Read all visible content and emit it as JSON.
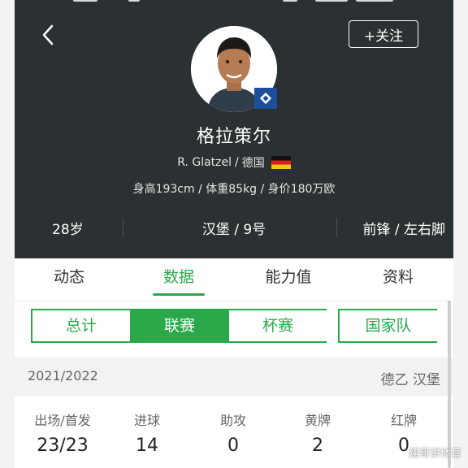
{
  "header": {
    "back_icon": "chevron-left-icon",
    "follow_label": "+关注"
  },
  "player": {
    "name_cn": "格拉策尔",
    "name_en": "R. Glatzel",
    "separator": "/",
    "nationality": "德国",
    "flag_icon": "germany-flag-icon",
    "physical": "身高193cm / 体重85kg / 身价180万欧",
    "age": "28岁",
    "club_number": "汉堡 / 9号",
    "position_foot": "前锋 / 左右脚",
    "club_badge_icon": "hamburg-badge-icon"
  },
  "tabs": [
    {
      "label": "动态",
      "active": false
    },
    {
      "label": "数据",
      "active": true
    },
    {
      "label": "能力值",
      "active": false
    },
    {
      "label": "资料",
      "active": false
    }
  ],
  "segments": [
    {
      "label": "总计",
      "active": false
    },
    {
      "label": "联赛",
      "active": true
    },
    {
      "label": "杯赛",
      "active": false
    },
    {
      "label": "国家队",
      "active": false
    }
  ],
  "season": {
    "label": "2021/2022",
    "league": "德乙 汉堡"
  },
  "stats": [
    {
      "label": "出场/首发",
      "value": "23/23"
    },
    {
      "label": "进球",
      "value": "14"
    },
    {
      "label": "助攻",
      "value": "0"
    },
    {
      "label": "黄牌",
      "value": "2"
    },
    {
      "label": "红牌",
      "value": "0"
    }
  ],
  "watermark": "建哥讲体育",
  "colors": {
    "header_bg": "#2b3032",
    "accent_green": "#2aa84a",
    "season_bar_bg": "#f1f2f4"
  }
}
